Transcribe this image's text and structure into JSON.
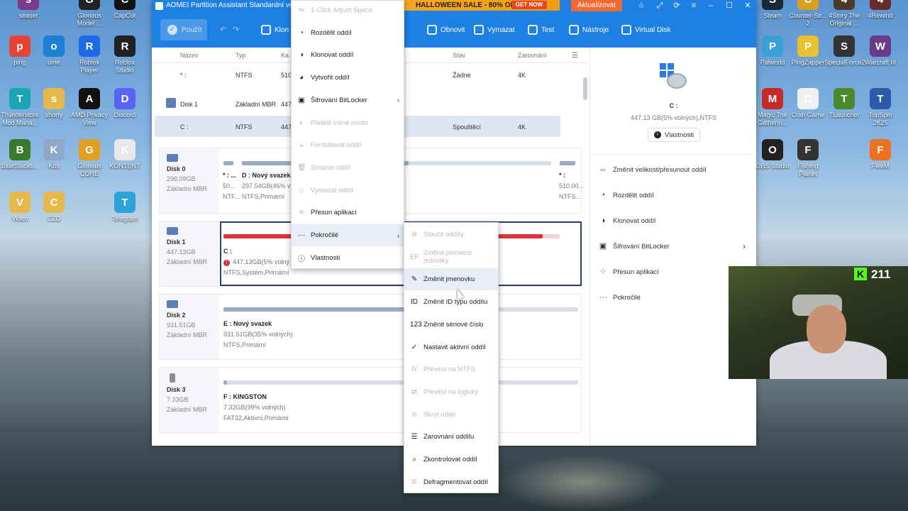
{
  "desktop": {
    "left_icons": [
      {
        "label": "seaser",
        "icon": "winrar-icon",
        "color": "#7a3a8a"
      },
      {
        "label": "Glorious Model ...",
        "icon": "glorious-icon",
        "color": "#222222"
      },
      {
        "label": "CapCut",
        "icon": "capcut-icon",
        "color": "#111111"
      },
      {
        "label": "ping",
        "icon": "chrome-icon",
        "color": "#e44335"
      },
      {
        "label": "ome",
        "icon": "edge-icon",
        "color": "#1b7fd3"
      },
      {
        "label": "Roblox Player",
        "icon": "roblox-icon",
        "color": "#1d6ae5"
      },
      {
        "label": "Roblox Studio",
        "icon": "roblox-studio-icon",
        "color": "#222222"
      },
      {
        "label": "Thunderstore Mod Mana...",
        "icon": "thunderstore-icon",
        "color": "#1aa5b5"
      },
      {
        "label": "shorty",
        "icon": "folder-icon",
        "color": "#e6b84a"
      },
      {
        "label": "AMD Privacy View",
        "icon": "amd-icon",
        "color": "#111111"
      },
      {
        "label": "Discord",
        "icon": "discord-icon",
        "color": "#5865f2"
      },
      {
        "label": "BlueStacks...",
        "icon": "bluestacks-icon",
        "color": "#3a7a2a"
      },
      {
        "label": "Koš",
        "icon": "recycle-bin-icon",
        "color": "#8fa8c8"
      },
      {
        "label": "Glorious CORE",
        "icon": "glorious-core-icon",
        "color": "#e0a020"
      },
      {
        "label": "KONTENT",
        "icon": "file-icon",
        "color": "#e8e8e8"
      },
      {
        "label": "Video",
        "icon": "folder-icon",
        "color": "#e6b84a"
      },
      {
        "label": "CZD",
        "icon": "folder-icon",
        "color": "#e6b84a"
      },
      {
        "label": "Telegram",
        "icon": "telegram-icon",
        "color": "#2aa3db"
      }
    ],
    "right_icons": [
      {
        "label": "Steam",
        "icon": "steam-icon",
        "color": "#1b2838"
      },
      {
        "label": "Counter-Str... 2",
        "icon": "cs2-icon",
        "color": "#d8a020"
      },
      {
        "label": "4Story The Original ...",
        "icon": "4story-icon",
        "color": "#4a3a2a"
      },
      {
        "label": "4Rewind",
        "icon": "4rewind-icon",
        "color": "#6a2a2a"
      },
      {
        "label": "Palworld",
        "icon": "palworld-icon",
        "color": "#3aa0d8"
      },
      {
        "label": "PingZapper",
        "icon": "pingzapper-icon",
        "color": "#e8c030"
      },
      {
        "label": "SpecialForce2",
        "icon": "specialforce-icon",
        "color": "#333333"
      },
      {
        "label": "Warcraft III",
        "icon": "warcraft-icon",
        "color": "#6a3a8a"
      },
      {
        "label": "Magic The Gatherin...",
        "icon": "mtg-icon",
        "color": "#c82a2a"
      },
      {
        "label": "Crab Game",
        "icon": "crab-game-icon",
        "color": "#f0f0f0"
      },
      {
        "label": "TLauncher",
        "icon": "tlauncher-icon",
        "color": "#4a8a2a"
      },
      {
        "label": "TopSpin 2K25",
        "icon": "topspin-icon",
        "color": "#2a5aa8"
      },
      {
        "label": "OBS Studio",
        "icon": "obs-icon",
        "color": "#222222"
      },
      {
        "label": "Fishing Planet",
        "icon": "fishing-planet-icon",
        "color": "#333333"
      },
      {
        "label": "FiveM",
        "icon": "fivem-icon",
        "color": "#f07020"
      }
    ]
  },
  "window": {
    "title": "AOMEI Partition Assistant Standardní verze",
    "promo": "HALLOWEEN SALE - 80% OFF",
    "promo_cta": "GET NOW",
    "upgrade": "Aktualizovat"
  },
  "toolbar": {
    "apply": "Použít",
    "buttons": [
      {
        "label": "Klon",
        "icon": "clone-icon"
      },
      {
        "label": "Obnovit",
        "icon": "recover-icon"
      },
      {
        "label": "Vymazat",
        "icon": "wipe-icon"
      },
      {
        "label": "Test",
        "icon": "test-icon"
      },
      {
        "label": "Nástroje",
        "icon": "tools-icon"
      },
      {
        "label": "Virtual Disk",
        "icon": "virtual-disk-icon"
      }
    ]
  },
  "table": {
    "columns": [
      "Název",
      "Typ",
      "Ka",
      "Stav",
      "Zarovnání"
    ],
    "rows": [
      {
        "name": "* :",
        "type": "NTFS",
        "cap": "510",
        "status": "Žádné",
        "align": "4K"
      },
      {
        "name": "Disk 1",
        "type": "Základní MBR",
        "cap": "447",
        "status": "",
        "align": ""
      },
      {
        "name": "C :",
        "type": "NTFS",
        "cap": "447",
        "status": "Spouštěcí",
        "align": "4K"
      }
    ]
  },
  "disks": [
    {
      "name": "Disk 0",
      "size": "298.09GB",
      "kind": "Základní MBR",
      "parts": [
        {
          "name": "* : ...",
          "l1": "50...",
          "l2": "NTF..."
        },
        {
          "name": "D : Nový svazek",
          "l1": "297.54GB(46% vo",
          "l2": "NTFS,Primární"
        },
        {
          "name": "* :",
          "l1": "510.00...",
          "l2": "NTFS..."
        }
      ]
    },
    {
      "name": "Disk 1",
      "size": "447.13GB",
      "kind": "Základní MBR",
      "parts": [
        {
          "name": "C :",
          "l1": "447.13GB(5% volný",
          "l2": "NTFS,Systém,Primární"
        }
      ]
    },
    {
      "name": "Disk 2",
      "size": "931.51GB",
      "kind": "Základní MBR",
      "parts": [
        {
          "name": "E : Nový svazek",
          "l1": "931.51GB(35% volných)",
          "l2": "NTFS,Primární"
        }
      ]
    },
    {
      "name": "Disk 3",
      "size": "7.33GB",
      "kind": "Základní MBR",
      "parts": [
        {
          "name": "F : KINGSTON",
          "l1": "7.32GB(99% volných)",
          "l2": "FAT32,Aktivní,Primární"
        }
      ]
    }
  ],
  "usage": {
    "d_used": 0.54,
    "c_used": 0.95,
    "e_used": 0.65,
    "f_used": 0.01
  },
  "right_panel": {
    "drive": "C :",
    "info": "447.13 GB(5% volných),NTFS",
    "properties": "Vlastnosti",
    "actions": [
      {
        "label": "Změnit velikost/přesunout oddíl",
        "icon": "resize-icon"
      },
      {
        "label": "Rozdělit oddíl",
        "icon": "split-icon"
      },
      {
        "label": "Klonovat oddíl",
        "icon": "clone-icon"
      },
      {
        "label": "Šifrování BitLocker",
        "icon": "bitlocker-icon"
      },
      {
        "label": "Přesun aplikací",
        "icon": "app-mover-icon"
      },
      {
        "label": "Pokročilé",
        "icon": "more-icon"
      }
    ]
  },
  "context_menu": {
    "items": [
      {
        "label": "1-Click Adjust Space",
        "disabled": true,
        "icon": "adjust-icon"
      },
      {
        "label": "Rozdělit oddíl",
        "disabled": false,
        "icon": "split-icon"
      },
      {
        "label": "Klonovat oddíl",
        "disabled": false,
        "icon": "clone-icon"
      },
      {
        "label": "Vytvořit oddíl",
        "disabled": false,
        "icon": "create-icon"
      },
      {
        "label": "Šifrování BitLocker",
        "disabled": false,
        "icon": "bitlocker-icon",
        "submenu": true
      },
      {
        "label": "Přidělit volné místo",
        "disabled": true,
        "icon": "allocate-icon"
      },
      {
        "label": "Formátovat oddíl",
        "disabled": true,
        "icon": "format-icon"
      },
      {
        "label": "Smazat oddíl",
        "disabled": true,
        "icon": "delete-icon"
      },
      {
        "label": "Vymazat oddíl",
        "disabled": true,
        "icon": "wipe-icon"
      },
      {
        "label": "Přesun aplikací",
        "disabled": false,
        "icon": "app-mover-icon"
      },
      {
        "label": "Pokročilé",
        "disabled": false,
        "icon": "more-icon",
        "submenu": true,
        "highlight": true
      },
      {
        "label": "Vlastnosti",
        "disabled": false,
        "icon": "info-icon"
      }
    ]
  },
  "submenu": {
    "items": [
      {
        "label": "Sloučit oddíly",
        "disabled": true,
        "icon": "merge-icon"
      },
      {
        "label": "Změnit písmeno jednotky",
        "disabled": true,
        "icon": "drive-letter-icon"
      },
      {
        "label": "Změnit jmenovku",
        "disabled": false,
        "icon": "pencil-icon",
        "highlight": true
      },
      {
        "label": "Změnit ID typu oddílu",
        "disabled": false,
        "icon": "id-icon"
      },
      {
        "label": "Změnit sériové číslo",
        "disabled": false,
        "icon": "serial-icon"
      },
      {
        "label": "Nastavit aktivní oddíl",
        "disabled": false,
        "icon": "active-icon"
      },
      {
        "label": "Převést na NTFS",
        "disabled": true,
        "icon": "ntfs-icon"
      },
      {
        "label": "Převést na logický",
        "disabled": true,
        "icon": "logical-icon"
      },
      {
        "label": "Skrýt oddíl",
        "disabled": true,
        "icon": "hide-icon"
      },
      {
        "label": "Zarovnání oddílu",
        "disabled": false,
        "icon": "align-icon"
      },
      {
        "label": "Zkontrolovat oddíl",
        "disabled": false,
        "icon": "check-icon"
      },
      {
        "label": "Defragmentovat oddíl",
        "disabled": false,
        "icon": "defrag-icon"
      }
    ]
  },
  "stream": {
    "viewer_count": "211"
  }
}
